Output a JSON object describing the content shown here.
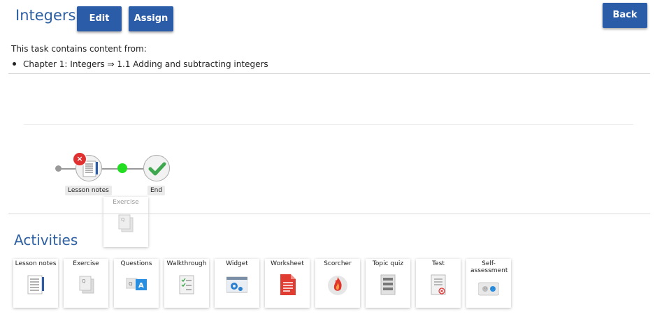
{
  "header": {
    "title": "Integers",
    "edit_label": "Edit",
    "assign_label": "Assign",
    "back_label": "Back"
  },
  "info": {
    "content_from": "This task contains content from:",
    "chapter": "Chapter 1: Integers ⇒ 1.1 Adding and subtracting integers"
  },
  "flow": {
    "nodes": [
      {
        "label": "Lesson notes",
        "icon": "lesson-notes-icon",
        "status": "error"
      },
      {
        "label": "End",
        "icon": "checkmark-icon"
      }
    ],
    "error_badge": "×",
    "dragging": {
      "label": "Exercise",
      "icon": "exercise-icon"
    }
  },
  "activities": {
    "title": "Activities",
    "items": [
      {
        "label": "Lesson notes",
        "icon": "lesson-notes-icon"
      },
      {
        "label": "Exercise",
        "icon": "exercise-icon"
      },
      {
        "label": "Questions",
        "icon": "questions-icon"
      },
      {
        "label": "Walkthrough",
        "icon": "walkthrough-icon"
      },
      {
        "label": "Widget",
        "icon": "widget-icon"
      },
      {
        "label": "Worksheet",
        "icon": "worksheet-icon"
      },
      {
        "label": "Scorcher",
        "icon": "scorcher-icon"
      },
      {
        "label": "Topic quiz",
        "icon": "topic-quiz-icon"
      },
      {
        "label": "Test",
        "icon": "test-icon"
      },
      {
        "label": "Self-assessment",
        "icon": "self-assessment-icon"
      }
    ]
  },
  "colors": {
    "accent": "#2a5ca8",
    "heading": "#2d5fa3",
    "error": "#e03030",
    "success": "#22dd22"
  }
}
